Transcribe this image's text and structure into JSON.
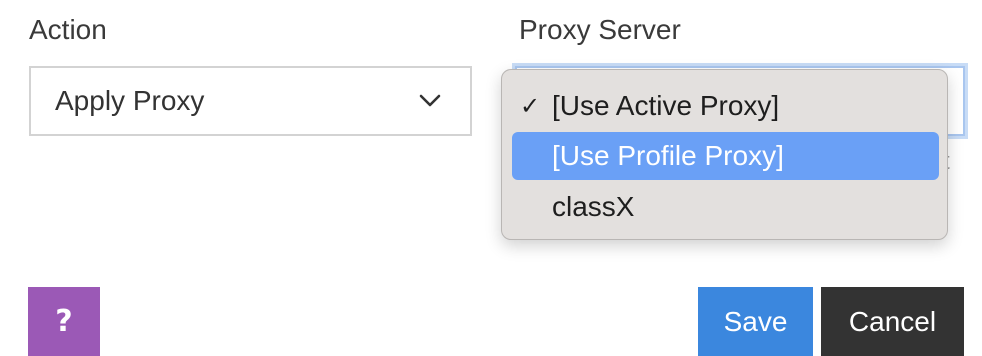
{
  "action": {
    "label": "Action",
    "selected": "Apply Proxy",
    "icon": "chevron-down-icon"
  },
  "proxy_server": {
    "label": "Proxy Server",
    "hint_fragment": "t",
    "options": [
      {
        "label": "[Use Active Proxy]",
        "checked": true,
        "highlighted": false
      },
      {
        "label": "[Use Profile Proxy]",
        "checked": false,
        "highlighted": true
      },
      {
        "label": "classX",
        "checked": false,
        "highlighted": false
      }
    ],
    "check_glyph": "✓"
  },
  "footer": {
    "help_label": "?",
    "save_label": "Save",
    "cancel_label": "Cancel"
  },
  "colors": {
    "help": "#9b59b6",
    "save": "#3b87de",
    "cancel": "#333333",
    "highlight": "#6aa0f6",
    "dropdown_bg": "#e3e0de"
  }
}
